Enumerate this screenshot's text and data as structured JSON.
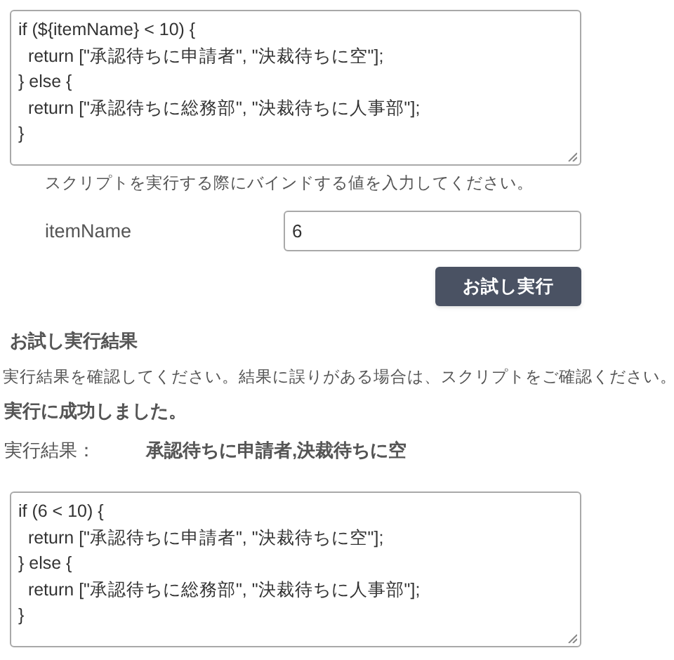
{
  "script_editor": {
    "lines": [
      "if (${itemName} < 10) {",
      "  return [\"承認待ちに申請者\", \"決裁待ちに空\"];",
      "} else {",
      "  return [\"承認待ちに総務部\", \"決裁待ちに人事部\"];",
      "}"
    ]
  },
  "bind_hint": "スクリプトを実行する際にバインドする値を入力してください。",
  "bindings": [
    {
      "label": "itemName",
      "value": "6"
    }
  ],
  "run_button": "お試し実行",
  "result_section": {
    "title": "お試し実行結果",
    "description": "実行結果を確認してください。結果に誤りがある場合は、スクリプトをご確認ください。",
    "status": "実行に成功しました。",
    "result_label": "実行結果：",
    "result_value": "承認待ちに申請者,決裁待ちに空"
  },
  "resolved_script": {
    "lines": [
      "if (6 < 10) {",
      "  return [\"承認待ちに申請者\", \"決裁待ちに空\"];",
      "} else {",
      "  return [\"承認待ちに総務部\", \"決裁待ちに人事部\"];",
      "}"
    ]
  }
}
